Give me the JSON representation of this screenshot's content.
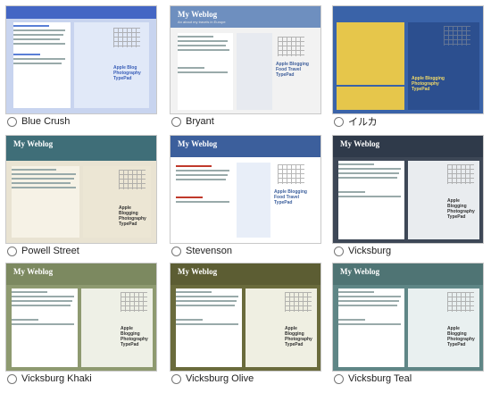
{
  "themes": [
    {
      "name": "Blue Crush",
      "header_title": "",
      "accent": "#5a7fd6",
      "bg": "#cfd9f2",
      "sidebar": "#d9e3f7"
    },
    {
      "name": "Bryant",
      "header_title": "My Weblog",
      "accent": "#4f6fae",
      "bg": "#f4f4f4",
      "sidebar": "#e9ecf2"
    },
    {
      "name": "イルカ",
      "header_title": "",
      "accent": "#3a63a8",
      "bg": "#bfcde4",
      "sidebar": "#e5c548"
    },
    {
      "name": "Powell Street",
      "header_title": "My Weblog",
      "accent": "#4e7f87",
      "bg": "#e7e1cf",
      "sidebar": "#eee8d6"
    },
    {
      "name": "Stevenson",
      "header_title": "My Weblog",
      "accent": "#3c5f9c",
      "bg": "#ffffff",
      "sidebar": "#e6edf7"
    },
    {
      "name": "Vicksburg",
      "header_title": "My Weblog",
      "accent": "#2f3a4a",
      "bg": "#ffffff",
      "sidebar": "#3d4756"
    },
    {
      "name": "Vicksburg Khaki",
      "header_title": "My Weblog",
      "accent": "#7c8960",
      "bg": "#ffffff",
      "sidebar": "#8e9a70"
    },
    {
      "name": "Vicksburg Olive",
      "header_title": "My Weblog",
      "accent": "#6a6b3c",
      "bg": "#ffffff",
      "sidebar": "#7b7c4a"
    },
    {
      "name": "Vicksburg Teal",
      "header_title": "My Weblog",
      "accent": "#4f7474",
      "bg": "#ffffff",
      "sidebar": "#5f8686"
    }
  ]
}
